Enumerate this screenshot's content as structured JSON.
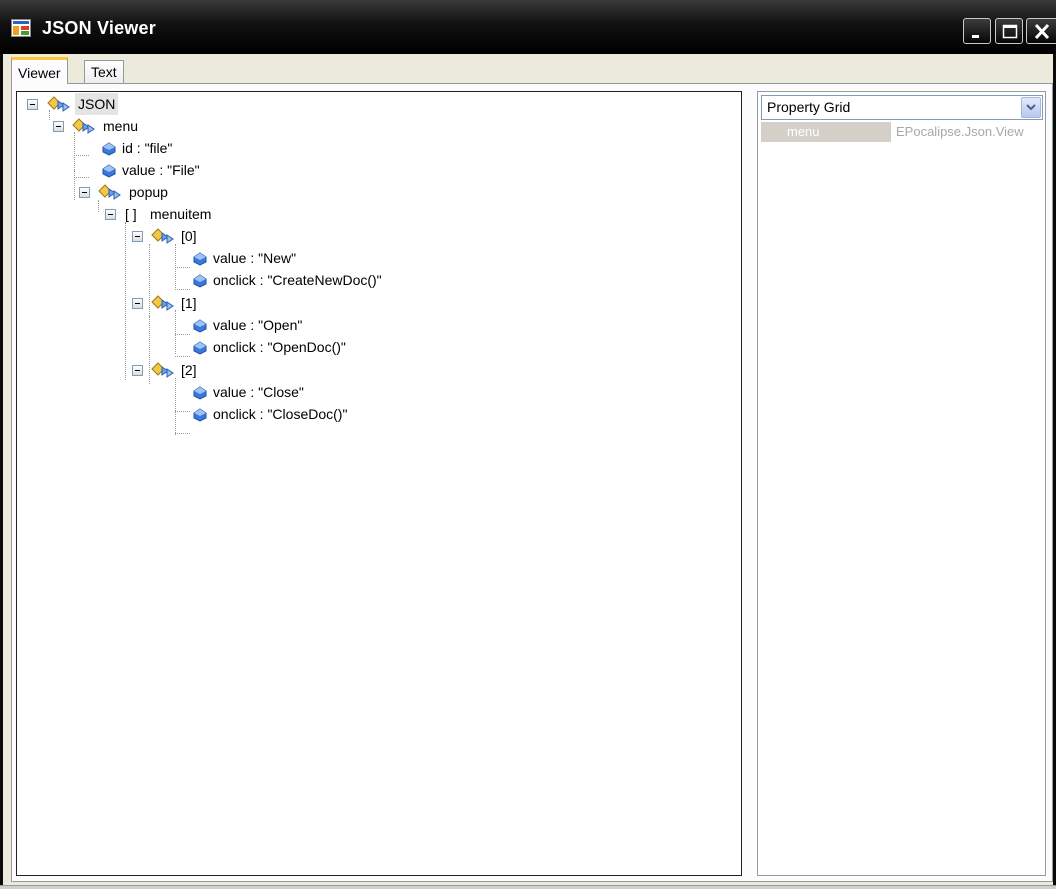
{
  "window": {
    "title": "JSON Viewer",
    "icon": "app-window-icon",
    "controls": {
      "minimize": "minimize-icon",
      "maximize": "maximize-icon",
      "close": "close-icon"
    }
  },
  "tabs": [
    {
      "label": "Viewer",
      "selected": true
    },
    {
      "label": "Text",
      "selected": false
    }
  ],
  "tree": {
    "nodes": [
      {
        "label": "JSON",
        "kind": "object",
        "selected": true
      },
      {
        "label": "menu",
        "kind": "object"
      },
      {
        "label": "id : \"file\"",
        "kind": "value"
      },
      {
        "label": "value : \"File\"",
        "kind": "value"
      },
      {
        "label": "popup",
        "kind": "object"
      },
      {
        "label": "menuitem",
        "kind": "array",
        "glyph": "[ ]"
      },
      {
        "label": "[0]",
        "kind": "object"
      },
      {
        "label": "value : \"New\"",
        "kind": "value"
      },
      {
        "label": "onclick : \"CreateNewDoc()\"",
        "kind": "value"
      },
      {
        "label": "[1]",
        "kind": "object"
      },
      {
        "label": "value : \"Open\"",
        "kind": "value"
      },
      {
        "label": "onclick : \"OpenDoc()\"",
        "kind": "value"
      },
      {
        "label": "[2]",
        "kind": "object"
      },
      {
        "label": "value : \"Close\"",
        "kind": "value"
      },
      {
        "label": "onclick : \"CloseDoc()\"",
        "kind": "value"
      }
    ]
  },
  "property_grid": {
    "selector": "Property Grid",
    "rows": [
      {
        "name": "menu",
        "value": "EPocalipse.Json.View"
      }
    ]
  },
  "colors": {
    "titlebar": "#000000",
    "tab_highlight": "#ffc83c",
    "object_icon_diamond": "#f2c84a",
    "value_icon": "#2f6bd6"
  }
}
